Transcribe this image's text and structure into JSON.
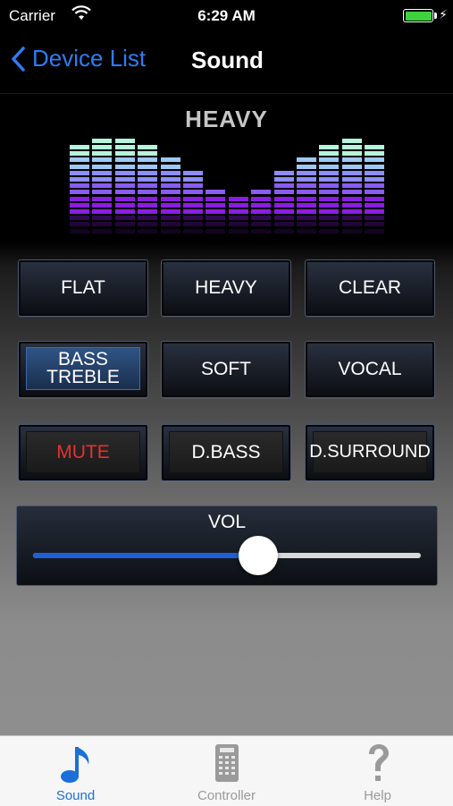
{
  "status_bar": {
    "carrier": "Carrier",
    "time": "6:29 AM",
    "battery_color": "#3ed13e"
  },
  "nav": {
    "back_label": "Device List",
    "title": "Sound"
  },
  "equalizer": {
    "preset": "HEAVY",
    "bands_level": [
      11,
      12,
      12,
      11,
      9,
      7,
      4,
      3,
      4,
      7,
      9,
      11,
      12,
      11
    ],
    "max_level": 12,
    "colors": {
      "top": "#a8f0d8",
      "mid": "#8a7dff",
      "bottom": "#8a1ee0"
    }
  },
  "presets": [
    {
      "label": "FLAT",
      "state": "normal"
    },
    {
      "label": "HEAVY",
      "state": "normal"
    },
    {
      "label": "CLEAR",
      "state": "normal"
    },
    {
      "label": "BASS\nTREBLE",
      "line1": "BASS",
      "line2": "TREBLE",
      "state": "selected"
    },
    {
      "label": "SOFT",
      "state": "normal"
    },
    {
      "label": "VOCAL",
      "state": "normal"
    },
    {
      "label": "MUTE",
      "state": "boxed",
      "color": "#e5322e"
    },
    {
      "label": "D.BASS",
      "state": "boxed"
    },
    {
      "label": "D.SURROUND",
      "state": "boxed"
    }
  ],
  "volume": {
    "label": "VOL",
    "level": 0.58,
    "accent": "#1e5fd8"
  },
  "tabs": [
    {
      "label": "Sound",
      "icon": "music-note-icon",
      "active": true
    },
    {
      "label": "Controller",
      "icon": "remote-icon",
      "active": false
    },
    {
      "label": "Help",
      "icon": "question-mark-icon",
      "active": false
    }
  ]
}
